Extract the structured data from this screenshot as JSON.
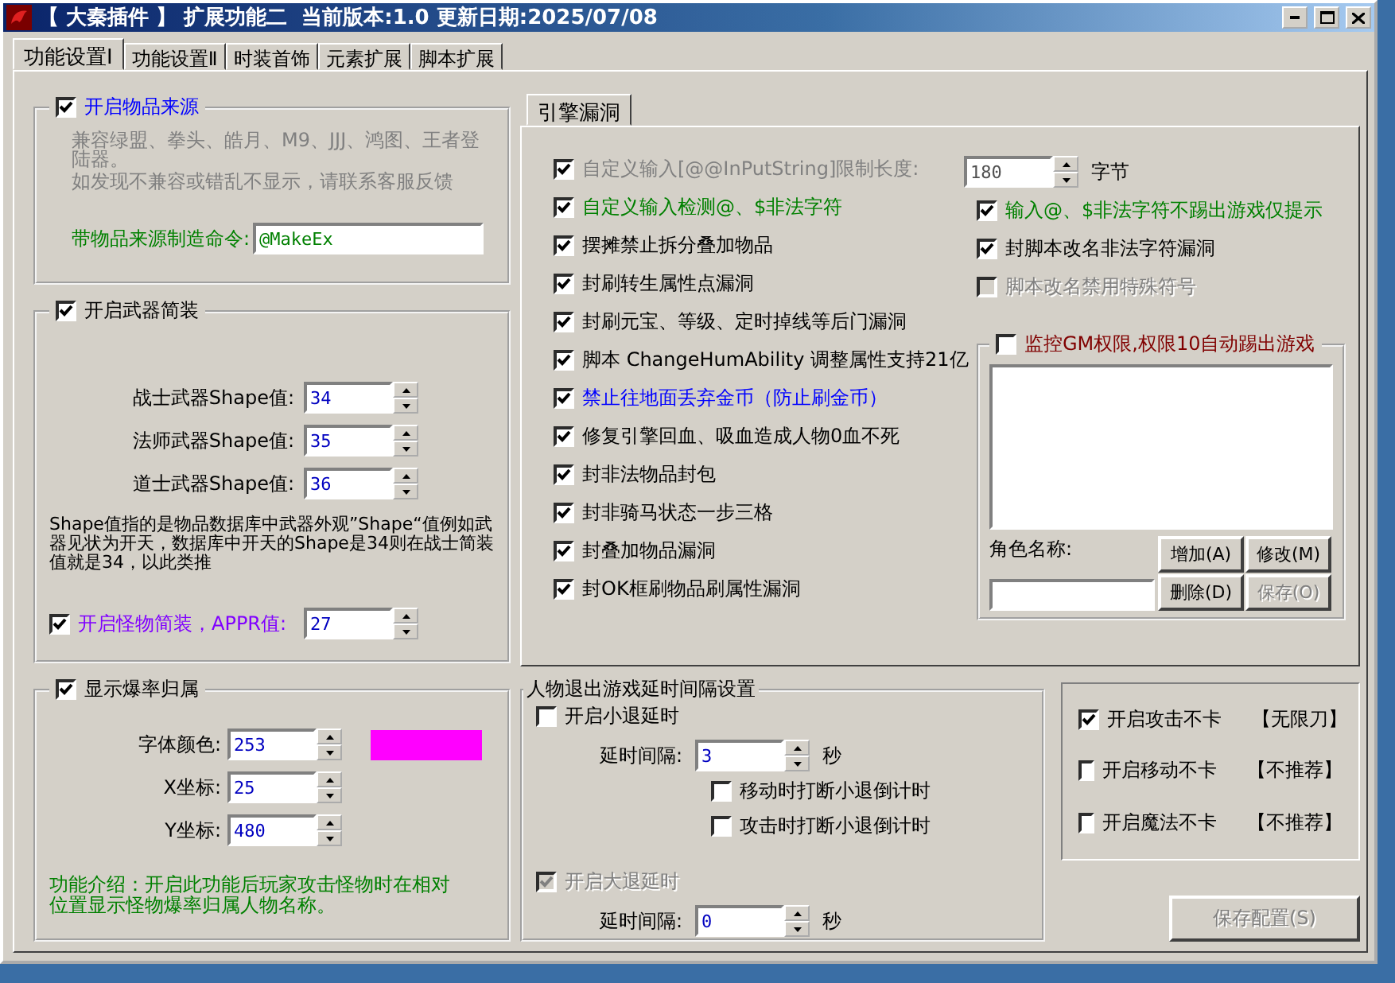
{
  "window": {
    "title": "【 大秦插件 】 扩展功能二  当前版本:1.0 更新日期:2025/07/08"
  },
  "tabs": [
    {
      "label": "功能设置Ⅰ",
      "selected": true
    },
    {
      "label": "功能设置Ⅱ",
      "selected": false
    },
    {
      "label": "时装首饰",
      "selected": false
    },
    {
      "label": "元素扩展",
      "selected": false
    },
    {
      "label": "脚本扩展",
      "selected": false
    }
  ],
  "item_source": {
    "checkbox": {
      "label": "开启物品来源",
      "checked": true,
      "color": "#0000ff"
    },
    "notes": [
      "兼容绿盟、拳头、皓月、M9、JJJ、鸿图、王者登陆器。",
      "如发现不兼容或错乱不显示，请联系客服反馈"
    ],
    "command": {
      "label": "带物品来源制造命令:",
      "color": "#008000",
      "value": "@MakeEx"
    }
  },
  "weapon": {
    "checkbox": {
      "label": "开启武器简装",
      "checked": true
    },
    "fields": [
      {
        "label": "战士武器Shape值:",
        "value": "34"
      },
      {
        "label": "法师武器Shape值:",
        "value": "35"
      },
      {
        "label": "道士武器Shape值:",
        "value": "36"
      }
    ],
    "note": "Shape值指的是物品数据库中武器外观”Shape“值例如武器见状为开天，数据库中开天的Shape是34则在战士简装值就是34，以此类推",
    "monster": {
      "label": "开启怪物简装，APPR值:",
      "checked": true,
      "color": "#8000ff",
      "value": "27"
    }
  },
  "drop": {
    "checkbox": {
      "label": "显示爆率归属",
      "checked": true
    },
    "color_field": {
      "label": "字体颜色:",
      "value": "253",
      "color": "#ff00ff"
    },
    "fields": [
      {
        "label": "X坐标:",
        "value": "25"
      },
      {
        "label": "Y坐标:",
        "value": "480"
      }
    ],
    "note": "功能介绍：开启此功能后玩家攻击怪物时在相对位置显示怪物爆率归属人物名称。"
  },
  "engine": {
    "tab": {
      "label": "引擎漏洞",
      "selected": true
    },
    "length": {
      "label": "自定义输入[@@InPutString]限制长度:",
      "checked": true,
      "color": "#808080",
      "value": "180",
      "unit": "字节"
    },
    "left": [
      {
        "label": "自定义输入检测@、$非法字符",
        "checked": true,
        "color": "#008000"
      },
      {
        "label": "摆摊禁止拆分叠加物品",
        "checked": true
      },
      {
        "label": "封刷转生属性点漏洞",
        "checked": true
      },
      {
        "label": "封刷元宝、等级、定时掉线等后门漏洞",
        "checked": true
      },
      {
        "label": "脚本 ChangeHumAbility 调整属性支持21亿",
        "checked": true
      },
      {
        "label": "禁止往地面丢弃金币（防止刷金币）",
        "checked": true,
        "color": "#0000ff"
      },
      {
        "label": "修复引擎回血、吸血造成人物0血不死",
        "checked": true
      },
      {
        "label": "封非法物品封包",
        "checked": true
      },
      {
        "label": "封非骑马状态一步三格",
        "checked": true
      },
      {
        "label": "封叠加物品漏洞",
        "checked": true
      },
      {
        "label": "封OK框刷物品刷属性漏洞",
        "checked": true
      }
    ],
    "right": [
      {
        "label": "输入@、$非法字符不踢出游戏仅提示",
        "checked": true,
        "color": "#008000",
        "disabled": false
      },
      {
        "label": "封脚本改名非法字符漏洞",
        "checked": true,
        "disabled": false
      },
      {
        "label": "脚本改名禁用特殊符号",
        "checked": false,
        "disabled": true
      }
    ],
    "gm": {
      "label": "监控GM权限,权限10自动踢出游戏",
      "checked": false,
      "color": "#800000",
      "name_label": "角色名称:",
      "buttons": [
        {
          "label": "增加(A)",
          "disabled": false
        },
        {
          "label": "修改(M)",
          "disabled": false
        },
        {
          "label": "删除(D)",
          "disabled": false
        },
        {
          "label": "保存(O)",
          "disabled": true
        }
      ]
    }
  },
  "logout": {
    "title": "人物退出游戏延时间隔设置",
    "small": {
      "label": "开启小退延时",
      "checked": false,
      "disabled": false,
      "interval_label": "延时间隔:",
      "value": "3",
      "unit": "秒",
      "options": [
        {
          "label": "移动时打断小退倒计时",
          "checked": false
        },
        {
          "label": "攻击时打断小退倒计时",
          "checked": false
        }
      ]
    },
    "big": {
      "label": "开启大退延时",
      "checked": true,
      "disabled": true,
      "interval_label": "延时间隔:",
      "value": "0",
      "unit": "秒"
    }
  },
  "no_lag": [
    {
      "label": "开启攻击不卡",
      "note": "【无限刀】",
      "checked": true
    },
    {
      "label": "开启移动不卡",
      "note": "【不推荐】",
      "checked": false
    },
    {
      "label": "开启魔法不卡",
      "note": "【不推荐】",
      "checked": false
    }
  ],
  "save_button": {
    "label": "保存配置(S)",
    "disabled": true
  }
}
